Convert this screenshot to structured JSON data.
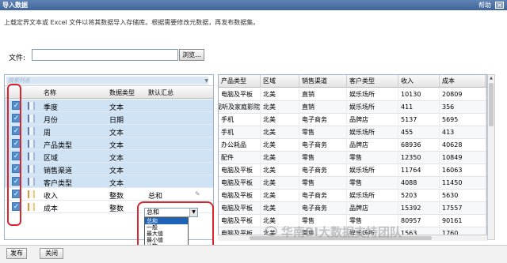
{
  "window": {
    "title": "导入数据",
    "help": "帮助",
    "close": "×"
  },
  "description": "上载定界文本或 Excel 文件以将其数据导入存储库。根据需要修改元数据，再发布数据集。",
  "file": {
    "label": "文件:",
    "value": "",
    "browse": "浏览..."
  },
  "search": {
    "placeholder": "搜索列名"
  },
  "field_columns": {
    "name": "名称",
    "type": "数据类型",
    "agg": "默认汇总"
  },
  "fields": [
    {
      "name": "季度",
      "type": "文本",
      "agg": "",
      "checked": true,
      "kind": "dim"
    },
    {
      "name": "月份",
      "type": "日期",
      "agg": "",
      "checked": true,
      "kind": "dim"
    },
    {
      "name": "周",
      "type": "文本",
      "agg": "",
      "checked": true,
      "kind": "dim"
    },
    {
      "name": "产品类型",
      "type": "文本",
      "agg": "",
      "checked": true,
      "kind": "dim"
    },
    {
      "name": "区域",
      "type": "文本",
      "agg": "",
      "checked": true,
      "kind": "dim"
    },
    {
      "name": "销售渠道",
      "type": "文本",
      "agg": "",
      "checked": true,
      "kind": "dim"
    },
    {
      "name": "客户类型",
      "type": "文本",
      "agg": "",
      "checked": true,
      "kind": "dim"
    },
    {
      "name": "收入",
      "type": "整数",
      "agg": "总和",
      "checked": true,
      "kind": "mea"
    },
    {
      "name": "成本",
      "type": "整数",
      "agg": "",
      "checked": true,
      "kind": "mea"
    }
  ],
  "agg_select": {
    "value": "总和",
    "options": [
      "总和",
      "一般",
      "最大值",
      "最小值",
      "计数",
      "无"
    ]
  },
  "preview": {
    "columns": [
      "产品类型",
      "区域",
      "销售渠道",
      "客户类型",
      "收入",
      "成本"
    ],
    "rows": [
      [
        "电脑及平板",
        "北美",
        "直销",
        "娱乐场所",
        "10130",
        "20809"
      ],
      [
        "家用视听及家庭影院",
        "北美",
        "直销",
        "娱乐场所",
        "411",
        "356"
      ],
      [
        "手机",
        "北美",
        "电子商务",
        "品牌店",
        "5137",
        "5695"
      ],
      [
        "手机",
        "北美",
        "零售",
        "娱乐场所",
        "455",
        "413"
      ],
      [
        "办公耗品",
        "北美",
        "电子商务",
        "品牌店",
        "68936",
        "40628"
      ],
      [
        "配件",
        "北美",
        "零售",
        "零售",
        "12350",
        "10849"
      ],
      [
        "电脑及平板",
        "北美",
        "电子商务",
        "娱乐场所",
        "11764",
        "16063"
      ],
      [
        "电脑及平板",
        "北美",
        "零售",
        "零售",
        "4088",
        "11450"
      ],
      [
        "电脑及平板",
        "北美",
        "电子商务",
        "娱乐场所",
        "5203",
        "5630"
      ],
      [
        "电脑及平板",
        "北美",
        "电子商务",
        "品牌店",
        "15392",
        "17557"
      ],
      [
        "电脑及平板",
        "北美",
        "零售",
        "零售",
        "80957",
        "90161"
      ],
      [
        "电脑及平板",
        "北美",
        "零售",
        "娱乐场所",
        "1563",
        "1760"
      ]
    ]
  },
  "buttons": {
    "publish": "发布",
    "close": "关闭"
  },
  "watermark": "华南BI大数据支持团队"
}
